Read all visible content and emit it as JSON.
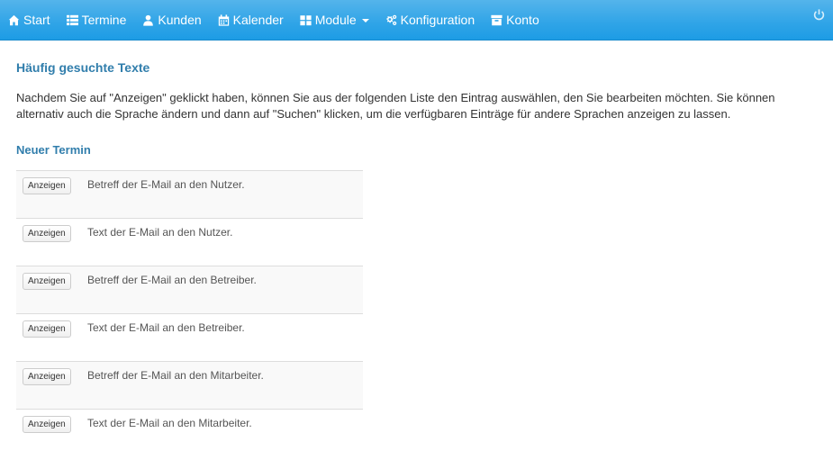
{
  "nav": {
    "items": [
      {
        "label": "Start",
        "icon": "home-icon"
      },
      {
        "label": "Termine",
        "icon": "list-icon"
      },
      {
        "label": "Kunden",
        "icon": "user-icon"
      },
      {
        "label": "Kalender",
        "icon": "calendar-icon"
      },
      {
        "label": "Module",
        "icon": "grid-icon",
        "dropdown": true
      },
      {
        "label": "Konfiguration",
        "icon": "cogs-icon"
      },
      {
        "label": "Konto",
        "icon": "inbox-icon"
      }
    ],
    "logout_icon": "power-icon"
  },
  "page": {
    "title": "Häufig gesuchte Texte",
    "intro": "Nachdem Sie auf \"Anzeigen\" geklickt haben, können Sie aus der folgenden Liste den Eintrag auswählen, den Sie bearbeiten möchten. Sie können alternativ auch die Sprache ändern und dann auf \"Suchen\" klicken, um die verfügbaren Einträge für andere Sprachen anzeigen zu lassen.",
    "section_title": "Neuer Termin"
  },
  "table": {
    "button_label": "Anzeigen",
    "rows": [
      {
        "text": "Betreff der E-Mail an den Nutzer."
      },
      {
        "text": "Text der E-Mail an den Nutzer."
      },
      {
        "text": "Betreff der E-Mail an den Betreiber."
      },
      {
        "text": "Text der E-Mail an den Betreiber."
      },
      {
        "text": "Betreff der E-Mail an den Mitarbeiter."
      },
      {
        "text": "Text der E-Mail an den Mitarbeiter."
      }
    ]
  },
  "colors": {
    "navbar": "#2fa4e7",
    "heading": "#317eac",
    "text": "#333333",
    "row_stripe": "#f9f9f9"
  }
}
